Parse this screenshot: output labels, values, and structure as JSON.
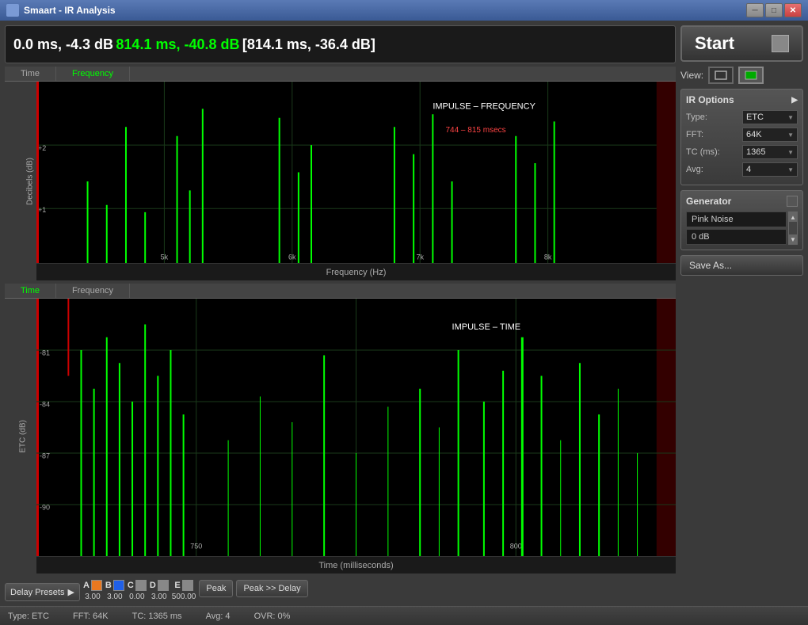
{
  "window": {
    "title": "Smaart - IR Analysis",
    "controls": [
      "minimize",
      "maximize",
      "close"
    ]
  },
  "info_bar": {
    "white1": "0.0 ms, -4.3 dB",
    "green": "814.1 ms, -40.8 dB",
    "bracket": "[814.1 ms, -36.4 dB]"
  },
  "top_chart": {
    "tabs": [
      "Time",
      "Frequency"
    ],
    "active_tab": "Frequency",
    "annotation": "IMPULSE – FREQUENCY",
    "annotation2": "744 – 815 msecs",
    "xlabel": "Frequency (Hz)",
    "ylabel": "Decibels (dB)",
    "y_labels": [
      "+2",
      "+1"
    ],
    "x_labels": [
      "5k",
      "6k",
      "7k",
      "8k"
    ]
  },
  "bottom_chart": {
    "tabs": [
      "Time",
      "Frequency"
    ],
    "active_tab": "Time",
    "annotation": "IMPULSE – TIME",
    "xlabel": "Time (milliseconds)",
    "ylabel": "ETC (dB)",
    "y_labels": [
      "-81",
      "-84",
      "-87",
      "-90"
    ],
    "x_labels": [
      "750",
      "800"
    ]
  },
  "right_panel": {
    "start_button": "Start",
    "view_label": "View:",
    "ir_options": {
      "title": "IR Options",
      "type_label": "Type:",
      "type_value": "ETC",
      "fft_label": "FFT:",
      "fft_value": "64K",
      "tc_label": "TC (ms):",
      "tc_value": "1365",
      "avg_label": "Avg:",
      "avg_value": "4"
    },
    "generator": {
      "title": "Generator",
      "noise_type": "Pink Noise",
      "db_value": "0 dB"
    },
    "save_as": "Save As..."
  },
  "bottom_toolbar": {
    "delay_presets": "Delay Presets",
    "presets": [
      {
        "letter": "A",
        "color": "#e87820",
        "value": "3.00"
      },
      {
        "letter": "B",
        "color": "#2060e8",
        "value": "3.00"
      },
      {
        "letter": "C",
        "color": "#888888",
        "value": "0.00"
      },
      {
        "letter": "D",
        "color": "#888888",
        "value": "3.00"
      },
      {
        "letter": "E",
        "color": "#888888",
        "value": "500.00"
      }
    ],
    "peak_button": "Peak",
    "peak_delay_button": "Peak >> Delay"
  },
  "status_bar": {
    "type": "Type: ETC",
    "fft": "FFT: 64K",
    "tc": "TC: 1365 ms",
    "avg": "Avg: 4",
    "ovr": "OVR: 0%"
  }
}
